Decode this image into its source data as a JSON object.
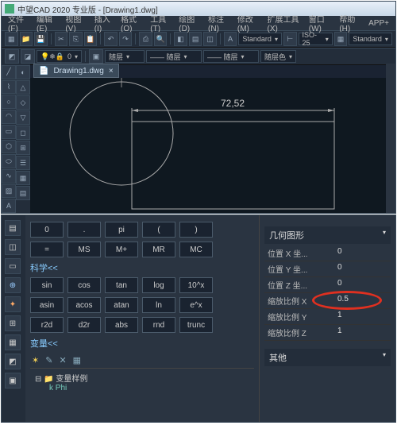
{
  "title": "中望CAD 2020 专业版 - [Drawing1.dwg]",
  "menus": [
    "文件(F)",
    "编辑(E)",
    "视图(V)",
    "插入(I)",
    "格式(O)",
    "工具(T)",
    "绘图(D)",
    "标注(N)",
    "修改(M)",
    "扩展工具(X)",
    "窗口(W)",
    "帮助(H)",
    "APP+"
  ],
  "tab_label": "Drawing1.dwg",
  "tb2_std1": "Standard",
  "tb2_iso": "ISO-25",
  "tb2_std2": "Standard",
  "tb3_layer0": "0",
  "tb3_sel1": "随层",
  "tb3_sel2": "—— 随层",
  "tb3_sel3": "—— 随层",
  "tb3_color": "随层色",
  "dimension_value": "72,52",
  "calc_rows": [
    [
      "0",
      ".",
      "pi",
      "(",
      ")"
    ],
    [
      "=",
      "MS",
      "M+",
      "MR",
      "MC"
    ]
  ],
  "sci_label": "科学<<",
  "sci_rows": [
    [
      "sin",
      "cos",
      "tan",
      "log",
      "10^x"
    ],
    [
      "asin",
      "acos",
      "atan",
      "ln",
      "e^x"
    ],
    [
      "r2d",
      "d2r",
      "abs",
      "rnd",
      "trunc"
    ]
  ],
  "var_label": "变量<<",
  "var_folder": "变量样例",
  "var_item": "Phi",
  "var_prefix": "k",
  "prop_group1": "几何图形",
  "prop_rows": [
    {
      "lbl": "位置 X 坐...",
      "val": "0"
    },
    {
      "lbl": "位置 Y 坐...",
      "val": "0"
    },
    {
      "lbl": "位置 Z 坐...",
      "val": "0"
    },
    {
      "lbl": "缩放比例 X",
      "val": "0.5",
      "hl": true
    },
    {
      "lbl": "缩放比例 Y",
      "val": "1"
    },
    {
      "lbl": "缩放比例 Z",
      "val": "1"
    }
  ],
  "prop_group2": "其他"
}
